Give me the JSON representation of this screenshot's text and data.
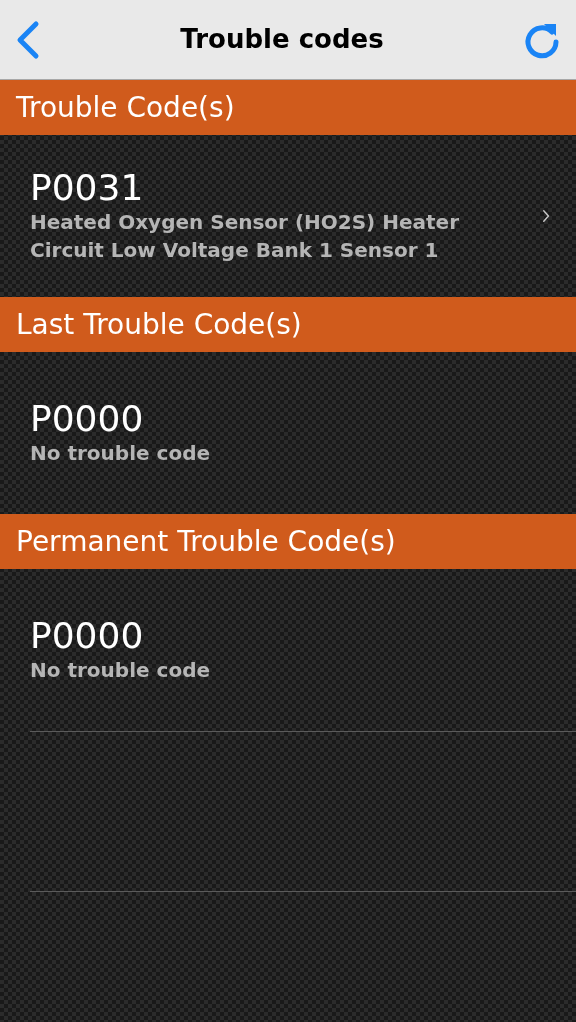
{
  "nav": {
    "title": "Trouble codes"
  },
  "sections": [
    {
      "title": "Trouble Code(s)",
      "items": [
        {
          "code": "P0031",
          "description": "Heated Oxygen Sensor (HO2S) Heater Circuit Low Voltage Bank 1 Sensor 1",
          "disclosure": true
        }
      ]
    },
    {
      "title": "Last Trouble Code(s)",
      "items": [
        {
          "code": "P0000",
          "description": "No trouble code",
          "disclosure": false
        }
      ]
    },
    {
      "title": "Permanent Trouble Code(s)",
      "items": [
        {
          "code": "P0000",
          "description": "No trouble code",
          "disclosure": false
        }
      ]
    }
  ]
}
